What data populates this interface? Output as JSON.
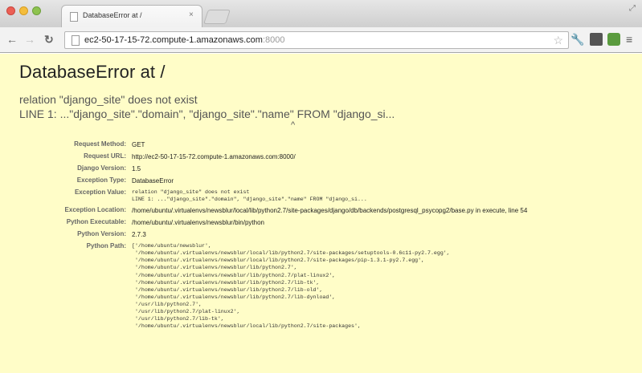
{
  "browser": {
    "tab_title": "DatabaseError at /",
    "tab_close": "×",
    "url_host": "ec2-50-17-15-72.compute-1.amazonaws.com",
    "url_port": ":8000"
  },
  "error": {
    "title": "DatabaseError at /",
    "exception_value": "relation \"django_site\" does not exist\nLINE 1: ...\"django_site\".\"domain\", \"django_site\".\"name\" FROM \"django_si...",
    "caret": "^"
  },
  "meta": {
    "request_method": {
      "label": "Request Method:",
      "value": "GET"
    },
    "request_url": {
      "label": "Request URL:",
      "value": "http://ec2-50-17-15-72.compute-1.amazonaws.com:8000/"
    },
    "django_version": {
      "label": "Django Version:",
      "value": "1.5"
    },
    "exception_type": {
      "label": "Exception Type:",
      "value": "DatabaseError"
    },
    "exception_value": {
      "label": "Exception Value:",
      "value": "relation \"django_site\" does not exist\nLINE 1: ...\"django_site\".\"domain\", \"django_site\".\"name\" FROM \"django_si..."
    },
    "exception_location": {
      "label": "Exception Location:",
      "value": "/home/ubuntu/.virtualenvs/newsblur/local/lib/python2.7/site-packages/django/db/backends/postgresql_psycopg2/base.py in execute, line 54"
    },
    "python_executable": {
      "label": "Python Executable:",
      "value": "/home/ubuntu/.virtualenvs/newsblur/bin/python"
    },
    "python_version": {
      "label": "Python Version:",
      "value": "2.7.3"
    },
    "python_path": {
      "label": "Python Path:",
      "value": "['/home/ubuntu/newsblur',\n '/home/ubuntu/.virtualenvs/newsblur/local/lib/python2.7/site-packages/setuptools-0.6c11-py2.7.egg',\n '/home/ubuntu/.virtualenvs/newsblur/local/lib/python2.7/site-packages/pip-1.3.1-py2.7.egg',\n '/home/ubuntu/.virtualenvs/newsblur/lib/python2.7',\n '/home/ubuntu/.virtualenvs/newsblur/lib/python2.7/plat-linux2',\n '/home/ubuntu/.virtualenvs/newsblur/lib/python2.7/lib-tk',\n '/home/ubuntu/.virtualenvs/newsblur/lib/python2.7/lib-old',\n '/home/ubuntu/.virtualenvs/newsblur/lib/python2.7/lib-dynload',\n '/usr/lib/python2.7',\n '/usr/lib/python2.7/plat-linux2',\n '/usr/lib/python2.7/lib-tk',\n '/home/ubuntu/.virtualenvs/newsblur/local/lib/python2.7/site-packages',"
    }
  },
  "colors": {
    "page_background": "#fffdc8",
    "close_button": "#ec5f55",
    "minimize_button": "#f4bd3c",
    "maximize_button": "#8ec34f"
  },
  "icons": [
    "close-icon",
    "back-arrow-icon",
    "forward-arrow-icon",
    "reload-icon",
    "page-icon",
    "star-icon",
    "wrench-icon",
    "menu-icon"
  ]
}
